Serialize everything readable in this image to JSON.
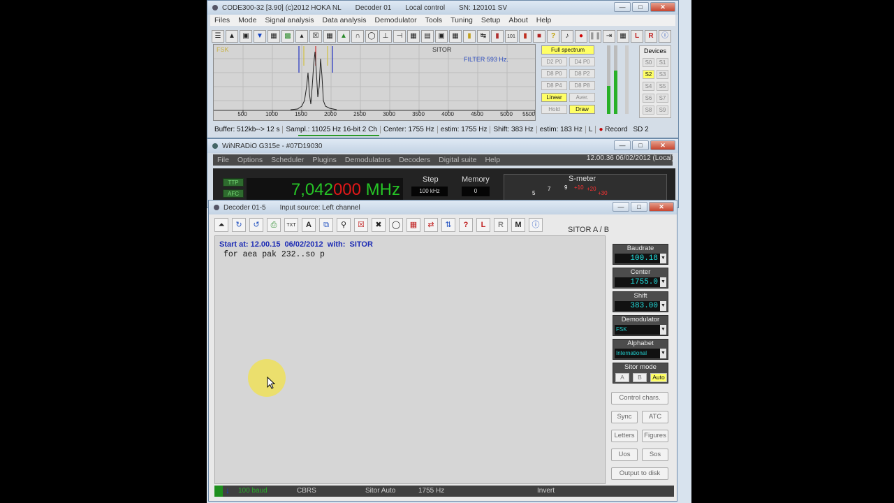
{
  "code300": {
    "title": "CODE300-32 [3.90] (c)2012 HOKA NL",
    "title_decoder": "Decoder 01",
    "title_control": "Local control",
    "title_sn": "SN: 120101 SV",
    "menu": [
      "Files",
      "Mode",
      "Signal analysis",
      "Data analysis",
      "Demodulator",
      "Tools",
      "Tuning",
      "Setup",
      "About",
      "Help"
    ],
    "spectrum": {
      "label_fsk": "FSK",
      "label_mode": "SITOR",
      "label_filter": "FILTER 593 Hz.",
      "axis_ticks": [
        "500",
        "1000",
        "1500",
        "2000",
        "2500",
        "3000",
        "3500",
        "4000",
        "4500",
        "5000",
        "5500"
      ]
    },
    "controls": {
      "full_spectrum": "Full spectrum",
      "d2p0": "D2 P0",
      "d4p0": "D4 P0",
      "d8p0": "D8 P0",
      "d8p2": "D8 P2",
      "d8p4": "D8 P4",
      "d8p8": "D8 P8",
      "linear": "Linear",
      "aver": "Aver.",
      "hold": "Hold",
      "draw": "Draw"
    },
    "devices": {
      "title": "Devices",
      "buttons": [
        "S0",
        "S1",
        "S2",
        "S3",
        "S4",
        "S5",
        "S6",
        "S7",
        "S8",
        "S9"
      ],
      "active": "S2"
    },
    "status": {
      "buffer": "Buffer: 512kb--> 12 s",
      "sampl": "Sampl.: 11025 Hz 16-bit 2 Ch",
      "center": "Center: 1755 Hz",
      "estim1": "estim: 1755 Hz",
      "shift": "Shift: 383 Hz",
      "estim2": "estim: 183 Hz",
      "channel": "L",
      "record": "Record",
      "sd": "SD 2"
    }
  },
  "winradio": {
    "title": "WiNRADiO G315e - #07D19030",
    "menu": [
      "File",
      "Options",
      "Scheduler",
      "Plugins",
      "Demodulators",
      "Decoders",
      "Digital suite",
      "Help"
    ],
    "datetime": "12.00.36  06/02/2012 (Local)",
    "ttp": "TTP",
    "afc": "AFC",
    "freq_main": "7,042",
    "freq_red": "000",
    "freq_unit": "MHz",
    "step_label": "Step",
    "step_value": "100 kHz",
    "memory_label": "Memory",
    "memory_value": "0",
    "smeter_label": "S-meter",
    "smeter_scale": [
      "5",
      "7",
      "9",
      "+10",
      "+20",
      "+30"
    ]
  },
  "decoder": {
    "title": "Decoder 01-5",
    "input_source": "Input source: Left channel",
    "mode_label": "SITOR A / B",
    "start_line": "Start at: 12.00.15  06/02/2012  with:  SITOR",
    "text_line": "for aea pak 232..so p",
    "baudrate_label": "Baudrate",
    "baudrate_value": "100.18",
    "center_label": "Center",
    "center_value": "1755.0",
    "shift_label": "Shift",
    "shift_value": "383.00",
    "demodulator_label": "Demodulator",
    "demodulator_value": "FSK",
    "alphabet_label": "Alphabet",
    "alphabet_value": "International",
    "sitor_mode_label": "Sitor mode",
    "sitor_mode_a": "A",
    "sitor_mode_b": "B",
    "sitor_mode_auto": "Auto",
    "control_chars": "Control chars.",
    "sync": "Sync",
    "atc": "ATC",
    "letters": "Letters",
    "figures": "Figures",
    "uos": "Uos",
    "sos": "Sos",
    "output_to_disk": "Output to disk",
    "status_baud": "100 baud",
    "status_cbrs": "CBRS",
    "status_mode": "Sitor Auto",
    "status_freq": "1755 Hz",
    "status_invert": "Invert"
  },
  "colors": {
    "freq_green": "#26c426",
    "freq_red": "#e01818",
    "highlight_yellow": "#ffff66",
    "value_cyan": "#22e0e0"
  }
}
